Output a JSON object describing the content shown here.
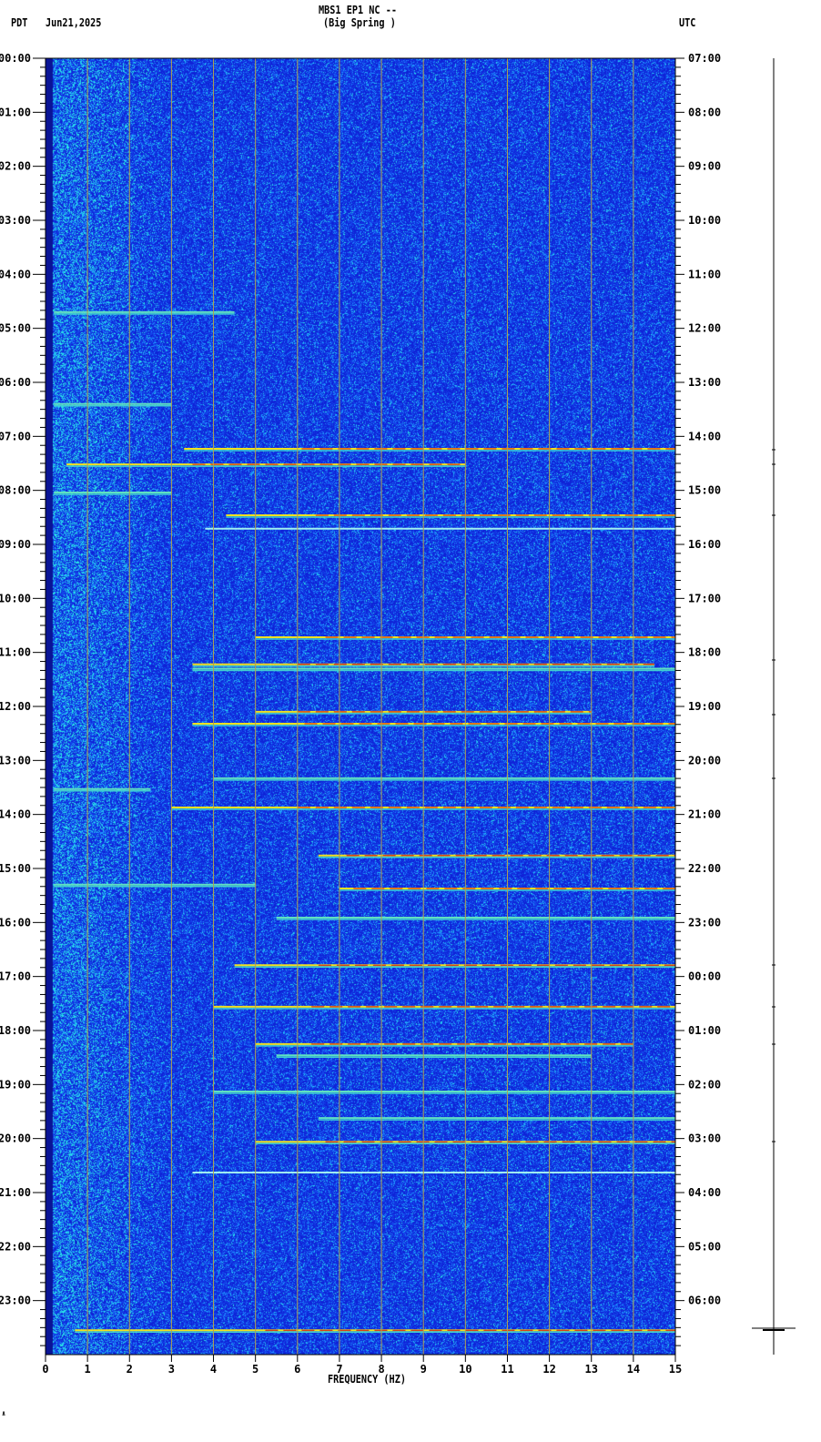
{
  "header": {
    "station": "MBS1 EP1 NC --",
    "location": "(Big Spring )",
    "left_tz": "PDT",
    "date": "Jun21,2025",
    "right_tz": "UTC"
  },
  "footer_mark": "∧",
  "chart_data": {
    "type": "heatmap",
    "title": "MBS1 EP1 NC -- (Big Spring )",
    "xlabel": "FREQUENCY (HZ)",
    "xlim": [
      0,
      15
    ],
    "x_ticks": [
      "0",
      "1",
      "2",
      "3",
      "4",
      "5",
      "6",
      "7",
      "8",
      "9",
      "10",
      "11",
      "12",
      "13",
      "14",
      "15"
    ],
    "ylim_hours": [
      0,
      24
    ],
    "y_left_ticks": [
      "00:00",
      "01:00",
      "02:00",
      "03:00",
      "04:00",
      "05:00",
      "06:00",
      "07:00",
      "08:00",
      "09:00",
      "10:00",
      "11:00",
      "12:00",
      "13:00",
      "14:00",
      "15:00",
      "16:00",
      "17:00",
      "18:00",
      "19:00",
      "20:00",
      "21:00",
      "22:00",
      "23:00"
    ],
    "y_right_ticks": [
      "07:00",
      "08:00",
      "09:00",
      "10:00",
      "11:00",
      "12:00",
      "13:00",
      "14:00",
      "15:00",
      "16:00",
      "17:00",
      "18:00",
      "19:00",
      "20:00",
      "21:00",
      "22:00",
      "23:00",
      "00:00",
      "01:00",
      "02:00",
      "03:00",
      "04:00",
      "05:00",
      "06:00"
    ],
    "colors": {
      "background": "#0a2adf",
      "noise": "#1f7fff",
      "event_hot": "#d01010",
      "event_warm": "#f0e020",
      "grid": "#b0a050"
    },
    "events": [
      {
        "hour": 4.7,
        "fmin": 0.2,
        "fmax": 4.5,
        "level": "med"
      },
      {
        "hour": 6.4,
        "fmin": 0.2,
        "fmax": 3.0,
        "level": "med"
      },
      {
        "hour": 7.23,
        "fmin": 3.3,
        "fmax": 15,
        "level": "high"
      },
      {
        "hour": 7.52,
        "fmin": 0.5,
        "fmax": 10,
        "level": "high"
      },
      {
        "hour": 8.04,
        "fmin": 0.2,
        "fmax": 3.0,
        "level": "med"
      },
      {
        "hour": 8.46,
        "fmin": 4.3,
        "fmax": 15,
        "level": "high"
      },
      {
        "hour": 8.71,
        "fmin": 3.8,
        "fmax": 15,
        "level": "low"
      },
      {
        "hour": 10.72,
        "fmin": 5,
        "fmax": 15,
        "level": "high"
      },
      {
        "hour": 11.22,
        "fmin": 3.5,
        "fmax": 14.5,
        "level": "high"
      },
      {
        "hour": 11.3,
        "fmin": 3.5,
        "fmax": 15,
        "level": "med"
      },
      {
        "hour": 12.1,
        "fmin": 5,
        "fmax": 13,
        "level": "high"
      },
      {
        "hour": 12.32,
        "fmin": 3.5,
        "fmax": 15,
        "level": "high"
      },
      {
        "hour": 13.33,
        "fmin": 4,
        "fmax": 15,
        "level": "med"
      },
      {
        "hour": 13.53,
        "fmin": 0.2,
        "fmax": 2.5,
        "level": "med"
      },
      {
        "hour": 13.87,
        "fmin": 3,
        "fmax": 15,
        "level": "high"
      },
      {
        "hour": 14.76,
        "fmin": 6.5,
        "fmax": 15,
        "level": "high"
      },
      {
        "hour": 15.3,
        "fmin": 0.2,
        "fmax": 5,
        "level": "med"
      },
      {
        "hour": 15.37,
        "fmin": 7,
        "fmax": 15,
        "level": "high"
      },
      {
        "hour": 15.91,
        "fmin": 5.5,
        "fmax": 15,
        "level": "med"
      },
      {
        "hour": 16.79,
        "fmin": 4.5,
        "fmax": 15,
        "level": "high"
      },
      {
        "hour": 17.56,
        "fmin": 4,
        "fmax": 15,
        "level": "high"
      },
      {
        "hour": 18.25,
        "fmin": 5,
        "fmax": 14,
        "level": "high"
      },
      {
        "hour": 18.46,
        "fmin": 5.5,
        "fmax": 13,
        "level": "med"
      },
      {
        "hour": 19.13,
        "fmin": 4,
        "fmax": 15,
        "level": "med"
      },
      {
        "hour": 19.62,
        "fmin": 6.5,
        "fmax": 15,
        "level": "med"
      },
      {
        "hour": 20.06,
        "fmin": 5,
        "fmax": 15,
        "level": "high"
      },
      {
        "hour": 20.63,
        "fmin": 3.5,
        "fmax": 15,
        "level": "low"
      },
      {
        "hour": 23.55,
        "fmin": 0.7,
        "fmax": 15,
        "level": "high"
      }
    ]
  }
}
